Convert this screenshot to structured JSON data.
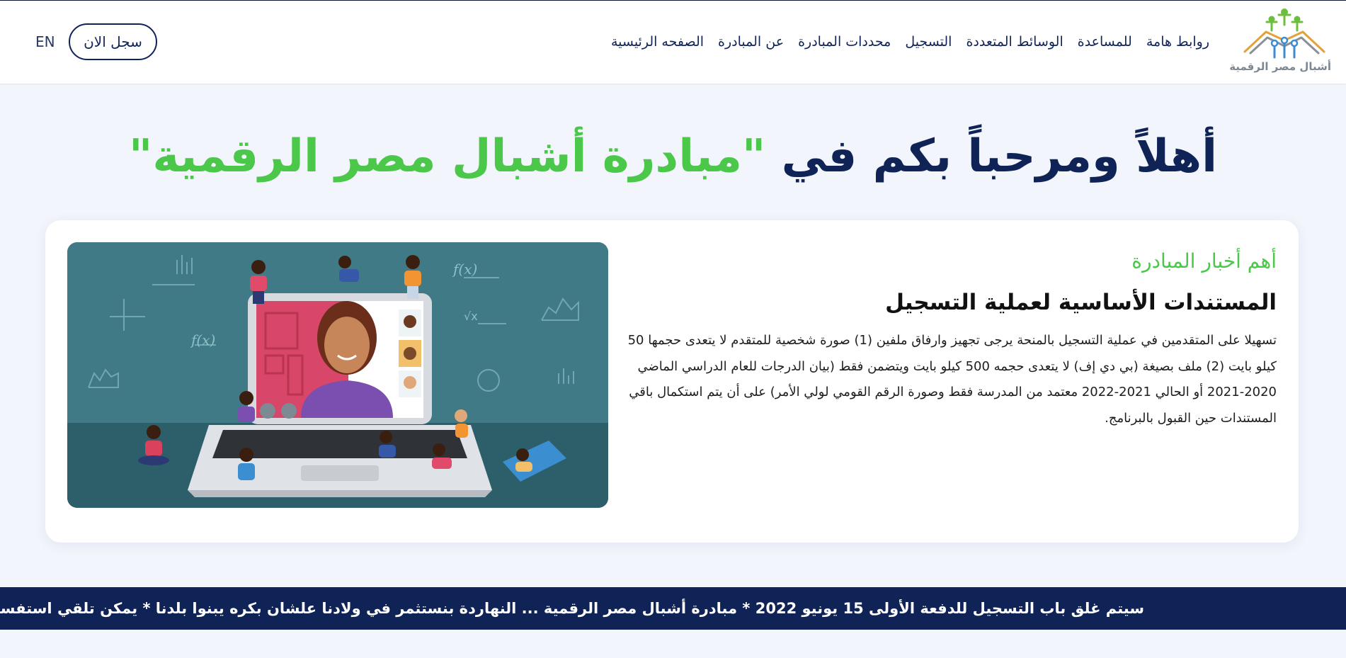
{
  "header": {
    "logo_text": "أشبال مصر الرقمية",
    "nav": [
      {
        "label": "الصفحه الرئيسية"
      },
      {
        "label": "عن المبادرة"
      },
      {
        "label": "محددات المبادرة"
      },
      {
        "label": "التسجيل"
      },
      {
        "label": "الوسائط المتعددة"
      },
      {
        "label": "للمساعدة"
      },
      {
        "label": "روابط هامة"
      }
    ],
    "register_label": "سجل الان",
    "lang_label": "EN"
  },
  "hero": {
    "title_prefix": "أهلاً ومرحباً بكم في ",
    "title_accent": "\"مبادرة أشبال مصر الرقمية\""
  },
  "news": {
    "label": "أهم أخبار المبادرة",
    "title": "المستندات الأساسية لعملية التسجيل",
    "body": "تسهيلا على المتقدمين في عملية التسجيل بالمنحة يرجى تجهيز وارفاق ملفين (1) صورة شخصية للمتقدم لا يتعدى حجمها 50 كيلو بايت (2) ملف بصيغة (بي دي إف) لا يتعدى حجمه 500 كيلو بايت ويتضمن فقط (بيان الدرجات للعام الدراسي الماضي 2020-2021 أو الحالي 2021-2022 معتمد من المدرسة فقط وصورة الرقم القومي لولي الأمر) على أن يتم استكمال باقي المستندات حين القبول بالبرنامج."
  },
  "ticker": {
    "text": "سيتم غلق باب التسجيل للدفعة الأولى 15 يونيو 2022 * مبادرة أشبال مصر الرقمية ... النهاردة بنستثمر في ولادنا علشان بكره يبنوا بلدنا * يمكن تلقي استفساراتكم"
  },
  "colors": {
    "navy": "#0f2356",
    "green": "#4bc74a",
    "page_bg": "#f2f5fc",
    "illustration_bg": "#3f7a86"
  },
  "icons": {
    "logo": "ashbal-logo-icon",
    "illustration": "online-learning-illustration"
  }
}
